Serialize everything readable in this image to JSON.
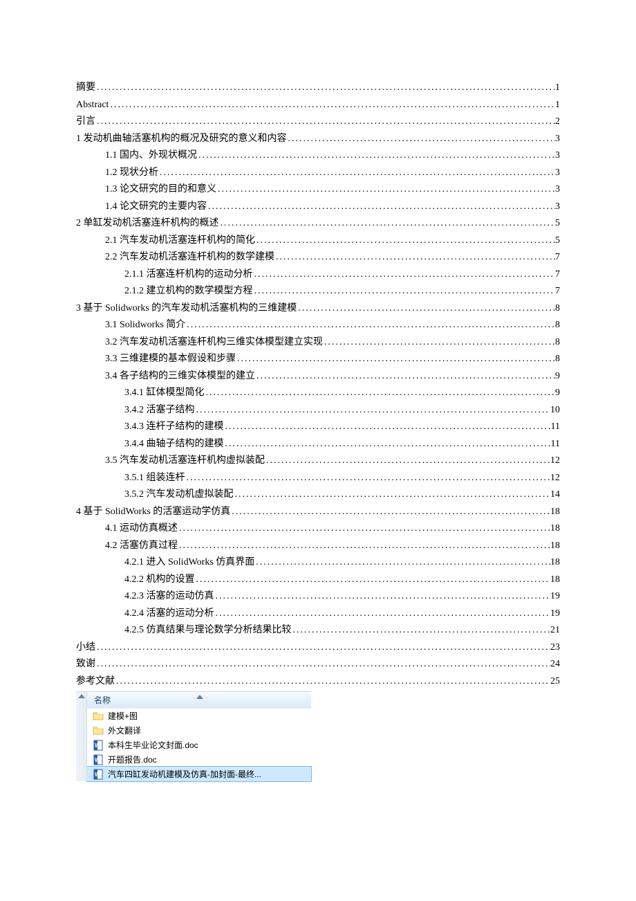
{
  "toc": [
    {
      "label": "摘要",
      "page": "1",
      "indent": 0
    },
    {
      "label": "Abstract",
      "page": "1",
      "indent": 0
    },
    {
      "label": "引言",
      "page": "2",
      "indent": 0
    },
    {
      "label": "1 发动机曲轴活塞机构的概况及研究的意义和内容",
      "page": "3",
      "indent": 0
    },
    {
      "label": "1.1 国内、外现状概况",
      "page": "3",
      "indent": 1
    },
    {
      "label": "1.2 现状分析",
      "page": "3",
      "indent": 1
    },
    {
      "label": "1.3 论文研究的目的和意义",
      "page": "3",
      "indent": 1
    },
    {
      "label": "1.4 论文研究的主要内容",
      "page": "3",
      "indent": 1
    },
    {
      "label": "2 单缸发动机活塞连杆机构的概述",
      "page": "5",
      "indent": 0
    },
    {
      "label": "2.1 汽车发动机活塞连杆机构的简化",
      "page": "5",
      "indent": 1
    },
    {
      "label": "2.2 汽车发动机活塞连杆机构的数学建模",
      "page": "7",
      "indent": 1
    },
    {
      "label": "2.1.1 活塞连杆机构的运动分析",
      "page": "7",
      "indent": 2
    },
    {
      "label": "2.1.2 建立机构的数学模型方程",
      "page": "7",
      "indent": 2
    },
    {
      "label": "3 基于 Solidworks 的汽车发动机活塞机构的三维建模",
      "page": "8",
      "indent": 0
    },
    {
      "label": "3.1 Solidworks 简介",
      "page": "8",
      "indent": 1
    },
    {
      "label": "3.2 汽车发动机活塞连杆机构三维实体模型建立实现",
      "page": "8",
      "indent": 1
    },
    {
      "label": "3.3 三维建模的基本假设和步骤",
      "page": "8",
      "indent": 1
    },
    {
      "label": "3.4 各子结构的三维实体模型的建立",
      "page": "9",
      "indent": 1
    },
    {
      "label": "3.4.1 缸体模型简化",
      "page": "9",
      "indent": 2
    },
    {
      "label": "3.4.2 活塞子结构",
      "page": "10",
      "indent": 2
    },
    {
      "label": "3.4.3 连杆子结构的建模",
      "page": "11",
      "indent": 2
    },
    {
      "label": "3.4.4 曲轴子结构的建模",
      "page": "11",
      "indent": 2
    },
    {
      "label": "3.5 汽车发动机活塞连杆机构虚拟装配",
      "page": "12",
      "indent": 1
    },
    {
      "label": "3.5.1 组装连杆",
      "page": "12",
      "indent": 2
    },
    {
      "label": "3.5.2 汽车发动机虚拟装配",
      "page": "14",
      "indent": 2
    },
    {
      "label": "4 基于 SolidWorks 的活塞运动学仿真",
      "page": "18",
      "indent": 0
    },
    {
      "label": "4.1 运动仿真概述",
      "page": "18",
      "indent": 1
    },
    {
      "label": "4.2 活塞仿真过程",
      "page": "18",
      "indent": 1
    },
    {
      "label": "4.2.1 进入 SolidWorks 仿真界面",
      "page": "18",
      "indent": 2
    },
    {
      "label": "4.2.2  机构的设置",
      "page": "18",
      "indent": 2
    },
    {
      "label": "4.2.3 活塞的运动仿真",
      "page": "19",
      "indent": 2
    },
    {
      "label": "4.2.4 活塞的运动分析",
      "page": "19",
      "indent": 2
    },
    {
      "label": "4.2.5 仿真结果与理论数学分析结果比较",
      "page": "21",
      "indent": 2
    },
    {
      "label": "小结",
      "page": "23",
      "indent": 0
    },
    {
      "label": "致谢",
      "page": "24",
      "indent": 0
    },
    {
      "label": "参考文献",
      "page": "25",
      "indent": 0
    }
  ],
  "explorer": {
    "header": "名称",
    "items": [
      {
        "type": "folder",
        "name": "建模+图",
        "selected": false
      },
      {
        "type": "folder",
        "name": "外文翻译",
        "selected": false
      },
      {
        "type": "doc",
        "name": "本科生毕业论文封面.doc",
        "selected": false
      },
      {
        "type": "doc",
        "name": "开题报告.doc",
        "selected": false
      },
      {
        "type": "doc",
        "name": "汽车四缸发动机建模及仿真-加封面-最终...",
        "selected": true
      }
    ]
  }
}
